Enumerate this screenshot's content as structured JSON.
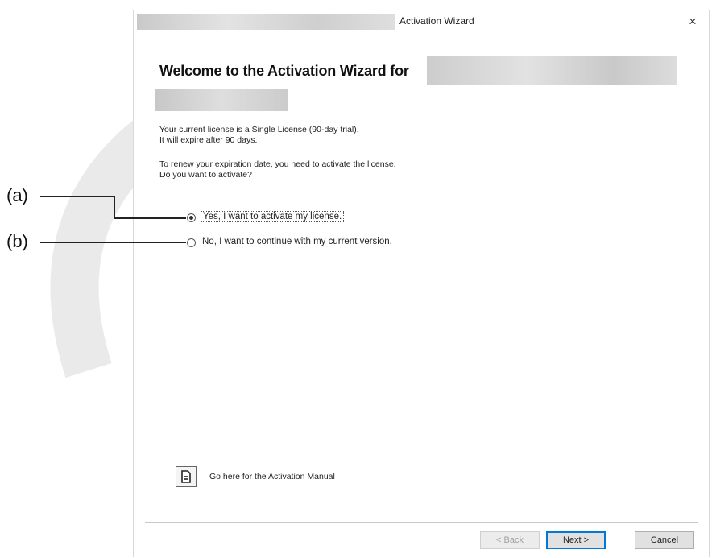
{
  "window": {
    "title": "Activation Wizard",
    "close_glyph": "×"
  },
  "content": {
    "heading": "Welcome to the Activation Wizard for",
    "license_line1": "Your current license is a Single License (90-day trial).",
    "license_line2": "It will expire after 90 days.",
    "renew_line1": "To renew your expiration date, you need to activate the license.",
    "renew_line2": "Do you want to activate?"
  },
  "options": [
    {
      "label": "Yes, I want to activate my license.",
      "checked": true
    },
    {
      "label": "No, I want to continue with my current version.",
      "checked": false
    }
  ],
  "manual": {
    "icon": "document-icon",
    "text": "Go here for the Activation Manual"
  },
  "buttons": {
    "back": "< Back",
    "next": "Next >",
    "cancel": "Cancel"
  },
  "callouts": {
    "a": "(a)",
    "b": "(b)"
  },
  "colors": {
    "accent": "#0078d7",
    "watermark": "#d9d9d9"
  }
}
